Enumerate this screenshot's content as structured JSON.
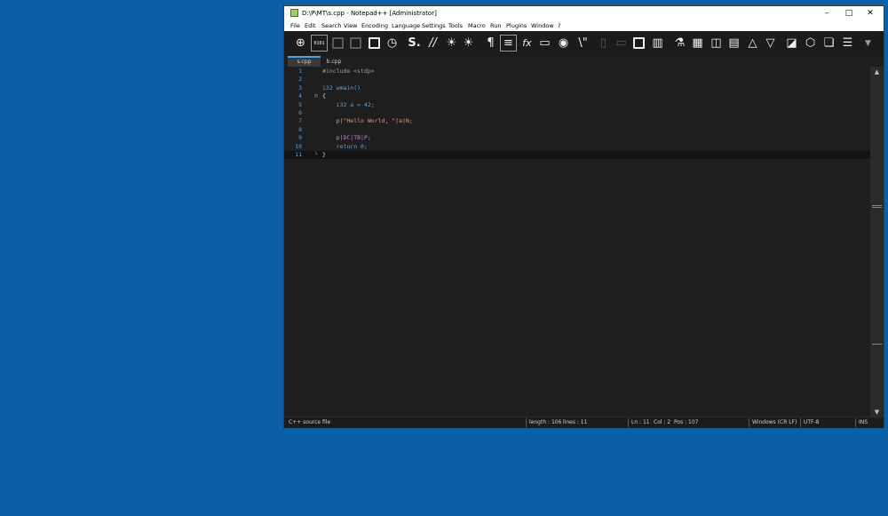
{
  "window": {
    "title": "D:\\P\\MT\\s.cpp - Notepad++ [Administrator]",
    "controls": {
      "minimize": "–",
      "maximize": "□",
      "close": "✕"
    }
  },
  "menu": [
    "File",
    "Edit",
    "Search",
    "View",
    "Encoding",
    "Language",
    "Settings",
    "Tools",
    "Macro",
    "Run",
    "Plugins",
    "Window",
    "?"
  ],
  "toolbar": {
    "icons": [
      "new-file-icon",
      "binary-view-icon",
      "save-icon",
      "save-all-icon",
      "book-icon",
      "history-icon",
      "spell-check-icon",
      "comment-icon",
      "debug-icon",
      "debug-alt-icon",
      "pilcrow-icon",
      "word-wrap-icon",
      "function-icon",
      "monitor-icon",
      "camera-icon",
      "escape-icon",
      "phone-icon",
      "resize-icon",
      "split-icon",
      "columns-icon",
      "flask-icon",
      "table-icon",
      "panel-icon",
      "document-icon",
      "triangle-up-icon",
      "triangle-down-icon",
      "chart-icon",
      "cube-icon",
      "plugin-icon",
      "list-icon",
      "overflow-icon"
    ],
    "glyphs": {
      "spell": "S.",
      "comment": "//",
      "pilcrow": "¶",
      "function": "fx",
      "escape": "\\\"",
      "binary": "0101"
    }
  },
  "tabs": [
    {
      "label": "s.cpp",
      "active": true
    },
    {
      "label": "b.cpp",
      "active": false
    }
  ],
  "editor": {
    "current_line": 11,
    "lines": [
      {
        "num": "1",
        "code": "#include <stdp>"
      },
      {
        "num": "2",
        "code": ""
      },
      {
        "num": "3",
        "code": "i32 wmain()"
      },
      {
        "num": "4",
        "code": "{"
      },
      {
        "num": "5",
        "code": "    i32 a = 42;"
      },
      {
        "num": "6",
        "code": ""
      },
      {
        "num": "7",
        "code": "    p|\"Hello World, \"|a|N;"
      },
      {
        "num": "8",
        "code": ""
      },
      {
        "num": "9",
        "code": "    p|DC|TB|P;"
      },
      {
        "num": "10",
        "code": "    return 0;"
      },
      {
        "num": "11",
        "code": "}"
      }
    ]
  },
  "status": {
    "file_type": "C++ source file",
    "length": "length : 106",
    "lines": "lines : 11",
    "ln": "Ln : 11",
    "col": "Col : 2",
    "pos": "Pos : 107",
    "eol": "Windows (CR LF)",
    "encoding": "UTF-8",
    "mode": "INS"
  },
  "colors": {
    "desktop": "#0b5fa5",
    "editor_bg": "#1e1e1e",
    "keyword": "#56a6e0",
    "line_number": "#5f9fd0",
    "active_tab_accent": "#4aa3df"
  }
}
